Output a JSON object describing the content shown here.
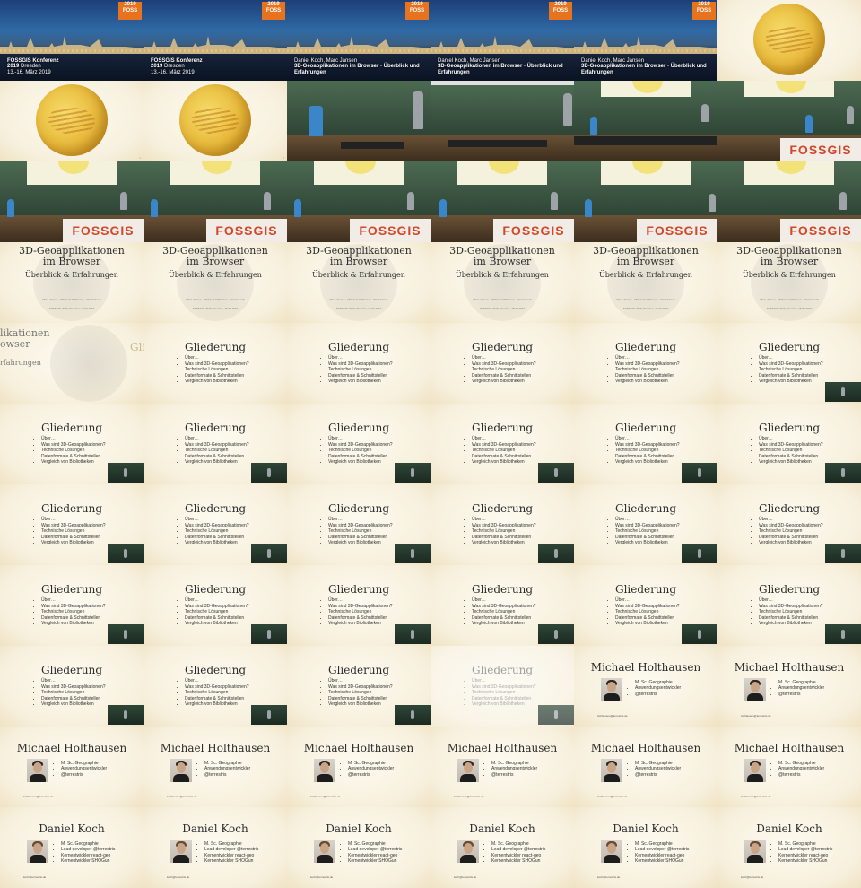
{
  "title_slide": {
    "logo_year": "2019",
    "logo_letters": "FOSS",
    "conference": "FOSSGIS Konferenz",
    "conference_year": "2019",
    "location": "Dresden",
    "dates": "13.-16. März 2019",
    "speakers": "Daniel Koch, Marc Jansen",
    "talk_title": "3D-Geoapplikationen im Browser - Überblick und Erfahrungen"
  },
  "hall": {
    "banner": "FOSSGIS"
  },
  "title_text": {
    "line1": "3D-Geoapplikationen",
    "line2": "im Browser",
    "subtitle": "Überblick & Erfahrungen",
    "small_line1": "Marc Jansen · Michael Holthausen · Daniel Koch",
    "small_line2": "FOSSGIS 2019, Dresden, 15.03.2019",
    "partial_line1": "likationen",
    "partial_line2": "owser",
    "partial_line3": "rfahrungen"
  },
  "agenda": {
    "title": "Gliederung",
    "partial_title": "Gli",
    "items": [
      "Über…",
      "Was sind 3D-Geoapplikationen?",
      "Technische Lösungen",
      "Datenformate & Schnittstellen",
      "Vergleich von Bibliotheken"
    ]
  },
  "speaker1": {
    "name": "Michael Holthausen",
    "items": [
      "M. Sc. Geographie",
      "Anwendungsentwickler",
      "@terrestris"
    ],
    "contact": "holthausen@terrestris.de"
  },
  "speaker2": {
    "name": "Daniel Koch",
    "items": [
      "M. Sc. Geographie",
      "Lead developer @terrestris",
      "Kernentwickler react-geo",
      "Kernentwickler SHOGun"
    ],
    "contact": "koch@terrestris.de"
  },
  "page_number": "3"
}
